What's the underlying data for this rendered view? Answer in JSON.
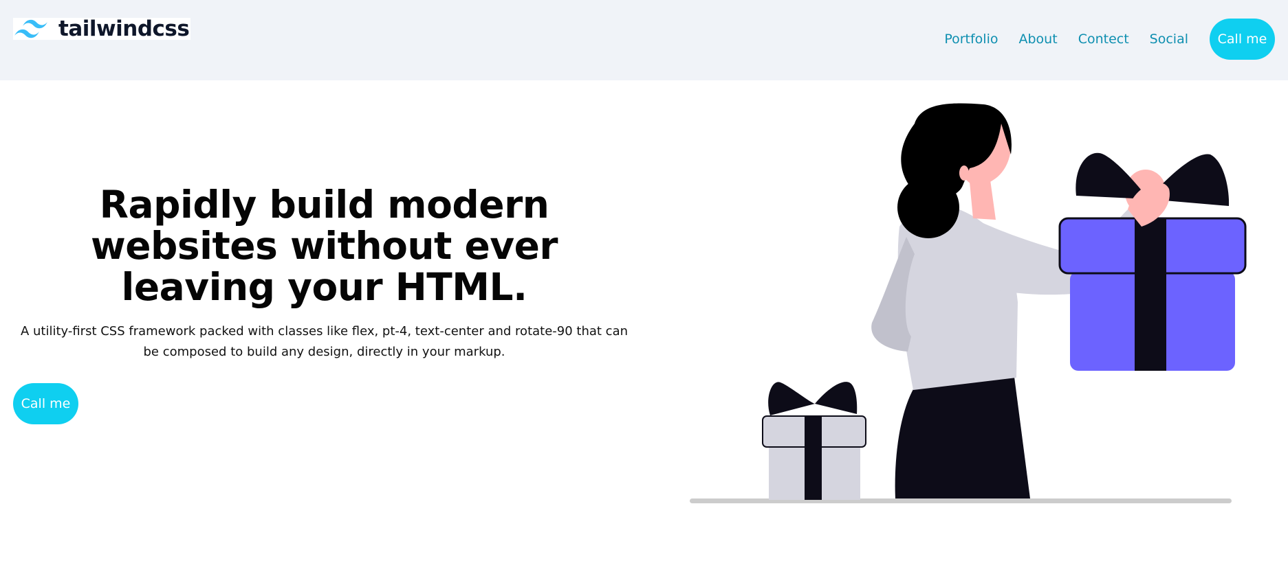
{
  "brand": {
    "name": "tailwindcss",
    "logo_icon": "tailwind-wave-logo",
    "logo_color": "#38bdf8"
  },
  "nav": {
    "links": [
      "Portfolio",
      "About",
      "Contect",
      "Social"
    ],
    "cta_label": "Call me"
  },
  "hero": {
    "title": "Rapidly build modern websites without ever leaving your HTML.",
    "subtitle": "A utility-first CSS framework packed with classes like flex, pt-4, text-center and rotate-90 that can be composed to build any design, directly in your markup.",
    "cta_label": "Call me"
  },
  "colors": {
    "header_bg": "#f0f3f8",
    "accent": "#0fcff0",
    "nav_link": "#0e8fb0",
    "gift_primary": "#6c63ff"
  },
  "illustration": {
    "subject": "woman-holding-gift-illustration"
  }
}
